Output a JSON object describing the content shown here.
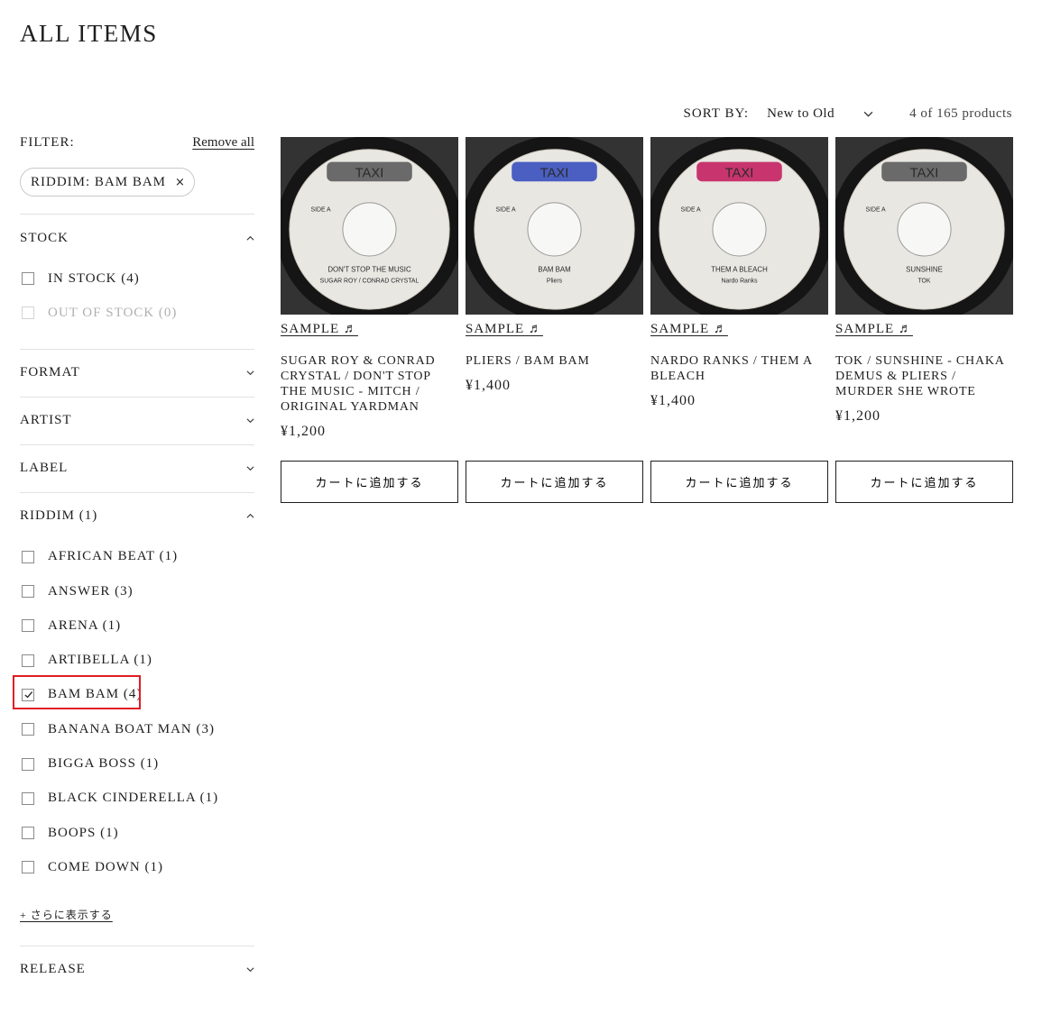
{
  "page": {
    "title": "ALL ITEMS"
  },
  "filter": {
    "label": "FILTER:",
    "remove_all": "Remove all",
    "active_pill": "RIDDIM: BAM BAM",
    "pill_close": "×",
    "stock": {
      "title": "STOCK",
      "options": [
        {
          "label": "IN STOCK (4)",
          "checked": false,
          "disabled": false
        },
        {
          "label": "OUT OF STOCK (0)",
          "checked": false,
          "disabled": true
        }
      ]
    },
    "format": {
      "title": "FORMAT"
    },
    "artist": {
      "title": "ARTIST"
    },
    "label_section": {
      "title": "LABEL"
    },
    "riddim": {
      "title": "RIDDIM (1)",
      "options": [
        {
          "label": "AFRICAN BEAT (1)",
          "checked": false
        },
        {
          "label": "ANSWER (3)",
          "checked": false
        },
        {
          "label": "ARENA (1)",
          "checked": false
        },
        {
          "label": "ARTIBELLA (1)",
          "checked": false
        },
        {
          "label": "BAM BAM (4)",
          "checked": true
        },
        {
          "label": "BANANA BOAT MAN (3)",
          "checked": false
        },
        {
          "label": "BIGGA BOSS (1)",
          "checked": false
        },
        {
          "label": "BLACK CINDERELLA (1)",
          "checked": false
        },
        {
          "label": "BOOPS (1)",
          "checked": false
        },
        {
          "label": "COME DOWN (1)",
          "checked": false
        }
      ],
      "show_more": "+ さらに表示する"
    },
    "release": {
      "title": "RELEASE"
    }
  },
  "toolbar": {
    "sort_label": "SORT BY:",
    "sort_value": "New to Old",
    "count": "4 of 165 products"
  },
  "products": [
    {
      "sample": "SAMPLE ♬",
      "title": "SUGAR ROY & CONRAD CRYSTAL / DON'T STOP THE MUSIC - MITCH / ORIGINAL YARDMAN",
      "price": "¥1,200",
      "cart": "カートに追加する",
      "label_logo": "TAXI",
      "taxi_color": "#6a6a6a",
      "label_side": "SIDE A",
      "label_song": "DON'T STOP THE MUSIC",
      "label_artist": "SUGAR ROY / CONRAD CRYSTAL"
    },
    {
      "sample": "SAMPLE ♬",
      "title": "PLIERS / BAM BAM",
      "price": "¥1,400",
      "cart": "カートに追加する",
      "label_logo": "TAXI",
      "taxi_color": "#4a5fc1",
      "label_side": "SIDE A",
      "label_song": "BAM BAM",
      "label_artist": "Pliers"
    },
    {
      "sample": "SAMPLE ♬",
      "title": "NARDO RANKS / THEM A BLEACH",
      "price": "¥1,400",
      "cart": "カートに追加する",
      "label_logo": "TAXI",
      "taxi_color": "#c8346e",
      "label_side": "SIDE A",
      "label_song": "THEM A BLEACH",
      "label_artist": "Nardo Ranks"
    },
    {
      "sample": "SAMPLE ♬",
      "title": "TOK / SUNSHINE - CHAKA DEMUS & PLIERS / MURDER SHE WROTE",
      "price": "¥1,200",
      "cart": "カートに追加する",
      "label_logo": "TAXI",
      "taxi_color": "#6a6a6a",
      "label_side": "SIDE A",
      "label_song": "SUNSHINE",
      "label_artist": "TOK"
    }
  ]
}
